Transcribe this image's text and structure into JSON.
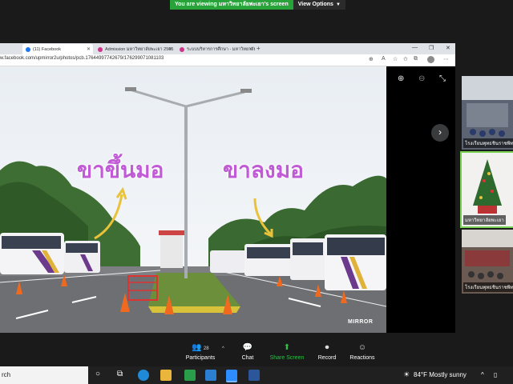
{
  "zoom_banner": {
    "message": "You are viewing มหาวิทยาลัยพะเยา's screen",
    "options_label": "View Options"
  },
  "browser": {
    "tabs": [
      {
        "label": "(11) Facebook",
        "active": true
      },
      {
        "label": "Admission มหาวิทยาลัยพะเยา 2565"
      },
      {
        "label": "ระบบบริหารการศึกษา - มหาวิทยาลัย"
      }
    ],
    "url": "w.facebook.com/upmirror2u/photos/pcb.17644997742679/176299071081103"
  },
  "photo": {
    "caption_left": "ขาขึ้นมอ",
    "caption_right": "ขาลงมอ",
    "watermark": "MIRROR"
  },
  "participants": [
    {
      "name": "โรงเรียนพุทธชินราชพิทยา",
      "speaking": false
    },
    {
      "name": "มหาวิทยาลัยพะเยา",
      "speaking": true
    },
    {
      "name": "โรงเรียนพุทธชินราชพิทยา",
      "speaking": false
    }
  ],
  "toolbar": {
    "participants_label": "Participants",
    "participants_count": "28",
    "chat_label": "Chat",
    "share_label": "Share Screen",
    "record_label": "Record",
    "reactions_label": "Reactions"
  },
  "taskbar": {
    "search_text": "rch",
    "weather": "84°F  Mostly sunny"
  },
  "colors": {
    "share_green": "#27a33a",
    "caption_purple": "#c05ad6",
    "speaker_outline": "#79d154"
  }
}
